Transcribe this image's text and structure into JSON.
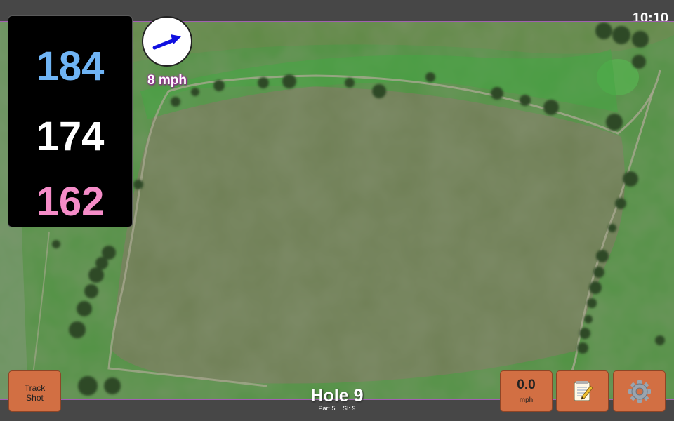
{
  "status": {
    "time": "10:10"
  },
  "distances": {
    "back": "184",
    "middle": "174",
    "front": "162"
  },
  "wind": {
    "speed": "8 mph",
    "direction_icon": "wind-arrow-icon"
  },
  "hole": {
    "title": "Hole 9",
    "par": "Par: 5",
    "stroke_index": "SI: 9"
  },
  "buttons": {
    "track_shot_line1": "Track",
    "track_shot_line2": "Shot",
    "speed_value": "0.0",
    "speed_unit": "mph",
    "notes_icon": "notepad-icon",
    "settings_icon": "gear-icon"
  },
  "colors": {
    "back": "#6fb4f5",
    "middle": "#ffffff",
    "front": "#f58cc8",
    "button": "#d26f43",
    "wind_arrow": "#1010e0"
  }
}
